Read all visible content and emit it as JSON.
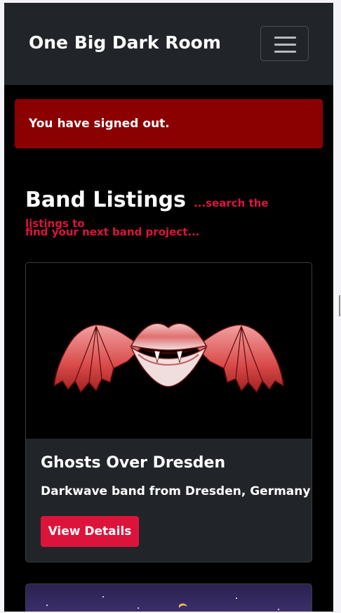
{
  "navbar": {
    "brand": "One Big Dark Room",
    "toggler_icon": "hamburger-icon"
  },
  "alert": {
    "message": "You have signed out."
  },
  "header": {
    "title": "Band Listings",
    "tagline_part1": "...search the listings to",
    "tagline_part2": "find your next band project..."
  },
  "listings": [
    {
      "image": "winged-lips-vampire-art",
      "title": "Ghosts Over Dresden",
      "description": "Darkwave band from Dresden, Germany",
      "button_label": "View Details"
    },
    {
      "image": "night-sky-moon-art"
    }
  ],
  "colors": {
    "navbar_bg": "#212529",
    "page_bg": "#000000",
    "alert_bg": "#8b0000",
    "accent": "#dc143c"
  }
}
